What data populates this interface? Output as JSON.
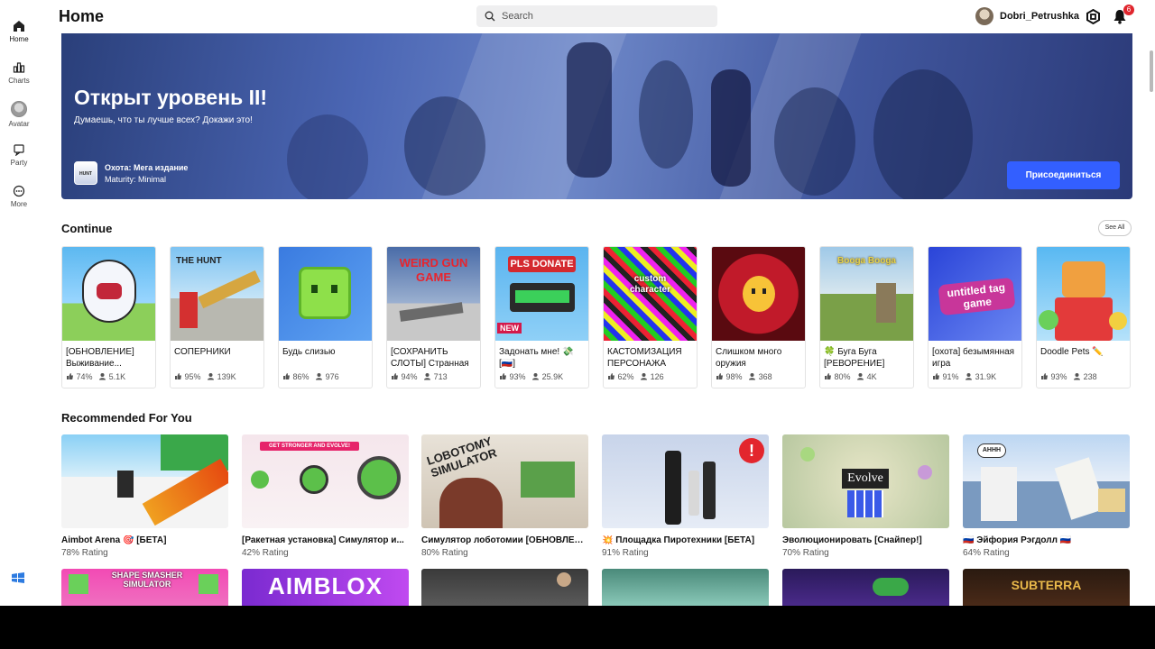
{
  "header": {
    "title": "Home",
    "search_placeholder": "Search",
    "username": "Dobri_Petrushka",
    "notification_count": "6"
  },
  "sidebar": {
    "items": [
      {
        "label": "Home",
        "icon": "home-icon"
      },
      {
        "label": "Charts",
        "icon": "charts-icon"
      },
      {
        "label": "Avatar",
        "icon": "avatar-icon"
      },
      {
        "label": "Party",
        "icon": "party-icon"
      },
      {
        "label": "More",
        "icon": "more-icon"
      }
    ]
  },
  "hero": {
    "title": "Открыт уровень II!",
    "subtitle": "Думаешь, что ты лучше всех? Докажи это!",
    "game_name": "Охота: Мега издание",
    "maturity": "Maturity: Minimal",
    "join_label": "Присоединиться",
    "thumb_text": "HUNT"
  },
  "continue": {
    "title": "Continue",
    "see_all": "See All",
    "items": [
      {
        "title": "[ОБНОВЛЕНИЕ] Выживание...",
        "rating": "74%",
        "players": "5.1K"
      },
      {
        "title": "СОПЕРНИКИ",
        "rating": "95%",
        "players": "139K"
      },
      {
        "title": "Будь слизью",
        "rating": "86%",
        "players": "976"
      },
      {
        "title": "[СОХРАНИТЬ СЛОТЫ] Странная",
        "rating": "94%",
        "players": "713"
      },
      {
        "title": "Задонать мне! 💸 [🇷🇺]",
        "rating": "93%",
        "players": "25.9K",
        "badge": "NEW"
      },
      {
        "title": "КАСТОМИЗАЦИЯ ПЕРСОНАЖА",
        "rating": "62%",
        "players": "126"
      },
      {
        "title": "Слишком много оружия",
        "rating": "98%",
        "players": "368"
      },
      {
        "title": "🍀 Буга Буга [РЕВОРЕНИЕ]",
        "rating": "80%",
        "players": "4K"
      },
      {
        "title": "[охота] безымянная игра",
        "rating": "91%",
        "players": "31.9K"
      },
      {
        "title": "Doodle Pets ✏️",
        "rating": "93%",
        "players": "238"
      }
    ],
    "thumb_texts": [
      "",
      "THE HUNT",
      "",
      "WEIRD GUN GAME",
      "PLS DONATE",
      "custom character",
      "",
      "Booga Booga",
      "untitled tag game",
      ""
    ]
  },
  "recommended": {
    "title": "Recommended For You",
    "items": [
      {
        "title": "Aimbot Arena 🎯 [БЕТА]",
        "rating": "78% Rating"
      },
      {
        "title": "[Ракетная установка] Симулятор и...",
        "rating": "42% Rating"
      },
      {
        "title": "Симулятор лоботомии [ОБНОВЛЕН...",
        "rating": "80% Rating"
      },
      {
        "title": "💥 Площадка Пиротехники [БЕТА]",
        "rating": "91% Rating"
      },
      {
        "title": "Эволюционировать [Снайпер!]",
        "rating": "70% Rating"
      },
      {
        "title": "🇷🇺 Эйфория Рэгдолл 🇷🇺",
        "rating": "64% Rating"
      }
    ],
    "thumb_texts": [
      "",
      "GET STRONGER AND EVOLVE!",
      "LOBOTOMY SIMULATOR",
      "",
      "Evolve",
      "AHHH"
    ],
    "row2_texts": [
      "SHAPE SMASHER SIMULATOR",
      "AIMBLOX",
      "",
      "",
      "",
      "SUBTERRA"
    ]
  },
  "colors": {
    "accent": "#335fff",
    "badge": "#e0262d"
  }
}
